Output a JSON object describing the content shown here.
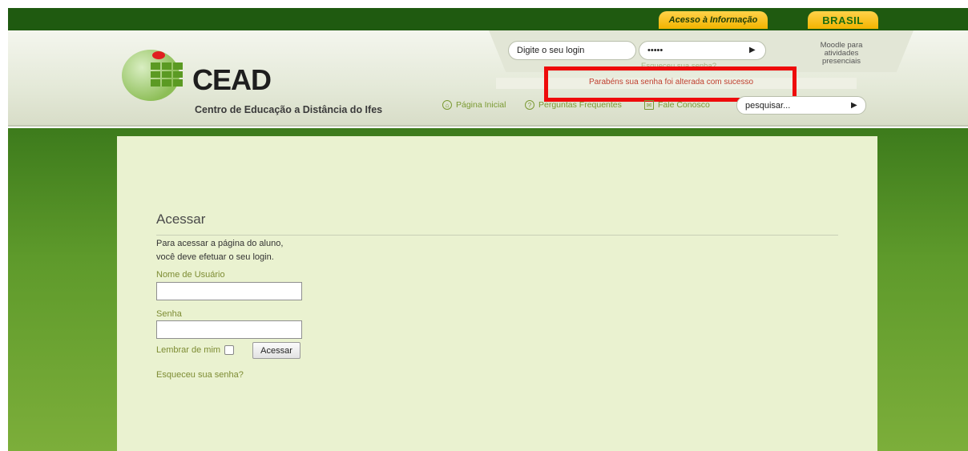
{
  "gov_bar": {
    "access_info": "Acesso à Informação",
    "brasil": "BRASIL"
  },
  "brand": {
    "name": "CEAD",
    "subtitle": "Centro de Educação a Distância do Ifes"
  },
  "top_login": {
    "username_placeholder": "Digite o seu login",
    "password_value": "•••••",
    "forgot_link": "Esqueceu sua senha?"
  },
  "moodle_link": "Moodle para atividades presenciais",
  "message": "Parabéns sua senha foi alterada com sucesso",
  "nav": {
    "home": "Página Inicial",
    "faq": "Perguntas Frequentes",
    "contact": "Fale Conosco"
  },
  "search": {
    "placeholder": "pesquisar..."
  },
  "login_form": {
    "title": "Acessar",
    "intro_line1": "Para acessar a página do aluno,",
    "intro_line2": "você deve efetuar o seu login.",
    "username_label": "Nome de Usuário",
    "password_label": "Senha",
    "remember_label": "Lembrar de mim",
    "submit_label": "Acessar",
    "forgot_link": "Esqueceu sua senha?"
  },
  "colors": {
    "gov_bar": "#1f5a10",
    "accent_green": "#7d8c33",
    "highlight_red": "#ee0b0b"
  }
}
